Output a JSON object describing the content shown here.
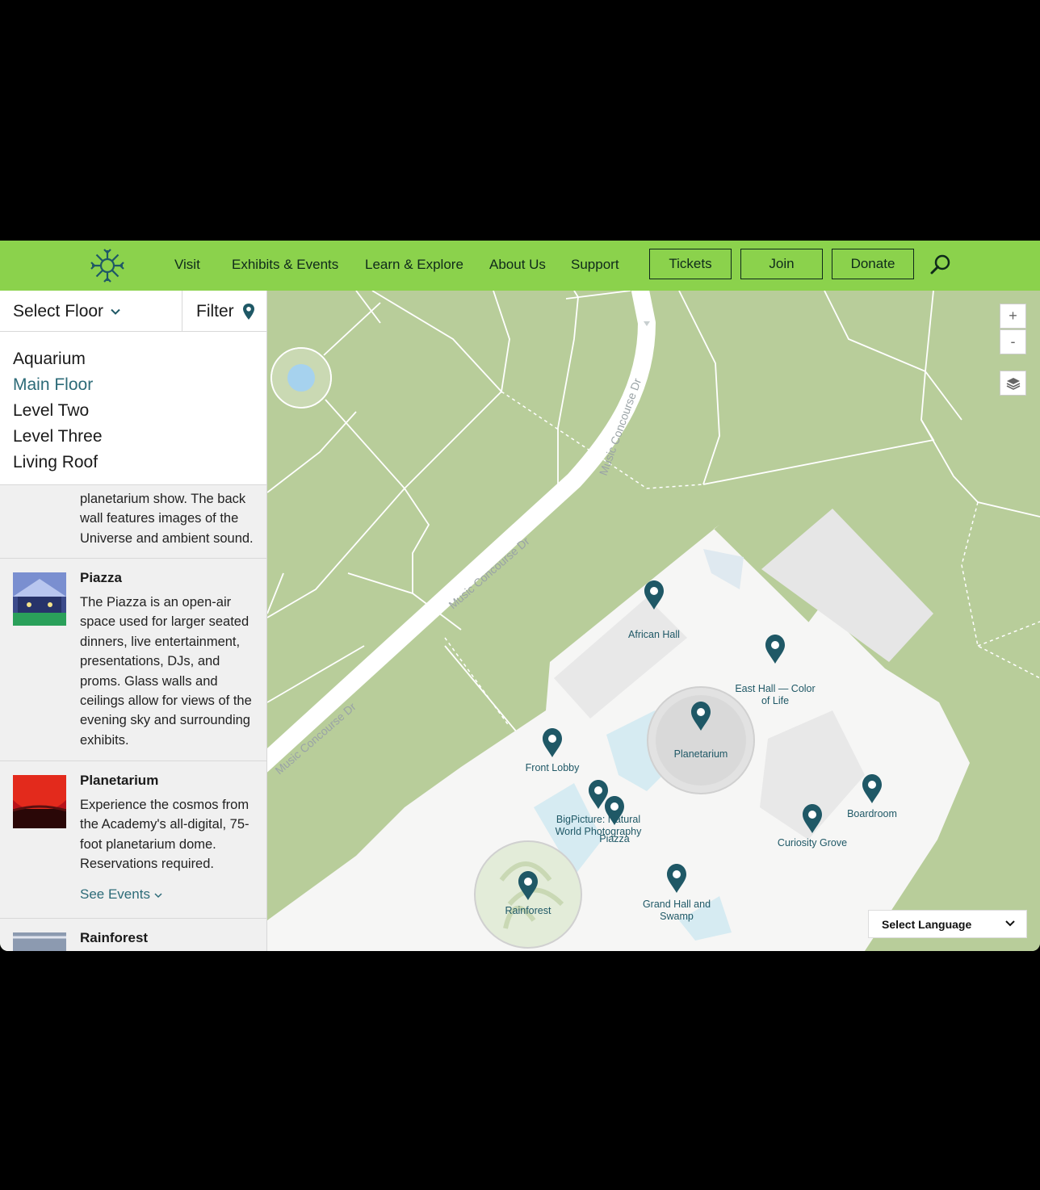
{
  "nav": {
    "links": [
      "Visit",
      "Exhibits & Events",
      "Learn & Explore",
      "About Us",
      "Support"
    ],
    "buttons": [
      "Tickets",
      "Join",
      "Donate"
    ],
    "logo_icon": "snowflake-logo-icon",
    "search_icon": "search-icon",
    "bar_color": "#8bd24c"
  },
  "panel": {
    "select_floor": "Select Floor",
    "filter": "Filter",
    "floors": [
      "Aquarium",
      "Main Floor",
      "Level Two",
      "Level Three",
      "Living Roof"
    ],
    "active_floor": "Main Floor",
    "partial_text": "planetarium show. The back wall features images of the Universe and ambient sound.",
    "entries": [
      {
        "title": "Piazza",
        "description": "The Piazza is an open-air space used for larger seated dinners, live entertainment, presentations, DJs, and proms. Glass walls and ceilings allow for views of the evening sky and surrounding exhibits."
      },
      {
        "title": "Planetarium",
        "description": "Experience the cosmos from the Academy's all-digital, 75-foot planetarium dome. Reservations required.",
        "link": "See Events"
      },
      {
        "title": "Rainforest"
      }
    ]
  },
  "map": {
    "zoom_in": "+",
    "zoom_out": "-",
    "roads": [
      "Music Concourse Dr",
      "Music Concourse Dr",
      "Music Concourse Dr"
    ],
    "pins": [
      "African Hall",
      "East Hall — Color of Life",
      "Planetarium",
      "Front Lobby",
      "BigPicture: Natural World Photography",
      "Piazza",
      "Boardroom",
      "Curiosity Grove",
      "Rainforest",
      "Grand Hall and Swamp"
    ],
    "language": "Select Language",
    "pin_color": "#1f5866",
    "grass_color": "#b8cd9a"
  }
}
